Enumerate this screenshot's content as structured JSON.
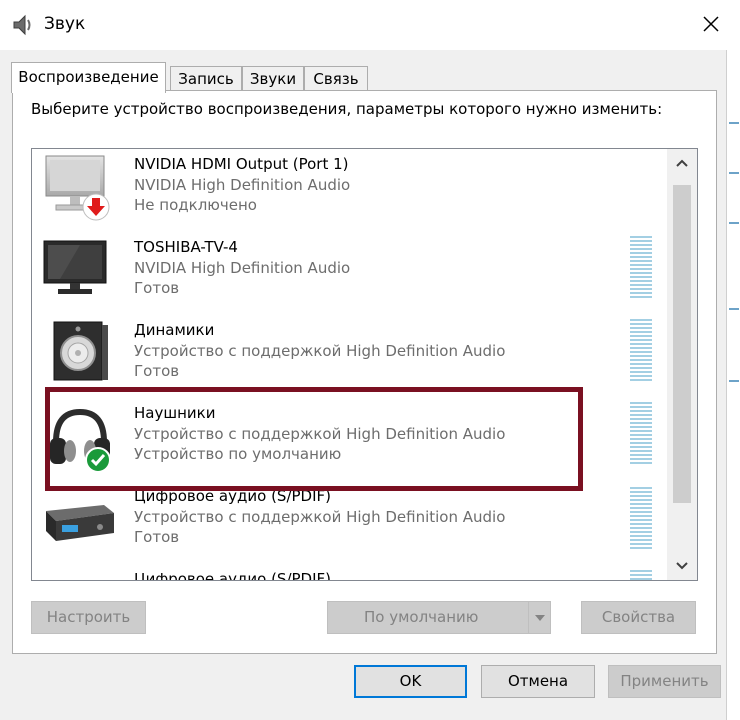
{
  "window": {
    "title": "Звук",
    "close_glyph": "✕"
  },
  "tabs": [
    {
      "label": "Воспроизведение",
      "active": true
    },
    {
      "label": "Запись",
      "active": false
    },
    {
      "label": "Звуки",
      "active": false
    },
    {
      "label": "Связь",
      "active": false
    }
  ],
  "instructions": "Выберите устройство воспроизведения, параметры которого нужно изменить:",
  "devices": [
    {
      "name": "NVIDIA HDMI Output (Port 1)",
      "driver": "NVIDIA High Definition Audio",
      "status": "Не подключено",
      "icon": "monitor-disconnected-icon"
    },
    {
      "name": "TOSHIBA-TV-4",
      "driver": "NVIDIA High Definition Audio",
      "status": "Готов",
      "icon": "tv-icon"
    },
    {
      "name": "Динамики",
      "driver": "Устройство с поддержкой High Definition Audio",
      "status": "Готов",
      "icon": "speaker-icon"
    },
    {
      "name": "Наушники",
      "driver": "Устройство с поддержкой High Definition Audio",
      "status": "Устройство по умолчанию",
      "icon": "headphones-default-icon"
    },
    {
      "name": "Цифровое аудио (S/PDIF)",
      "driver": "Устройство с поддержкой High Definition Audio",
      "status": "Готов",
      "icon": "digital-audio-icon"
    },
    {
      "name": "Цифровое аудио (S/PDIF)",
      "driver": "",
      "status": "",
      "icon": "digital-audio-icon"
    }
  ],
  "buttons": {
    "configure": "Настроить",
    "set_default": "По умолчанию",
    "properties": "Свойства",
    "ok": "OK",
    "cancel": "Отмена",
    "apply": "Применить"
  },
  "colors": {
    "highlight_border": "#7a1021",
    "default_check": "#1a9a3a",
    "disconnected_arrow": "#e01b1b",
    "primary_border": "#0078d7"
  }
}
